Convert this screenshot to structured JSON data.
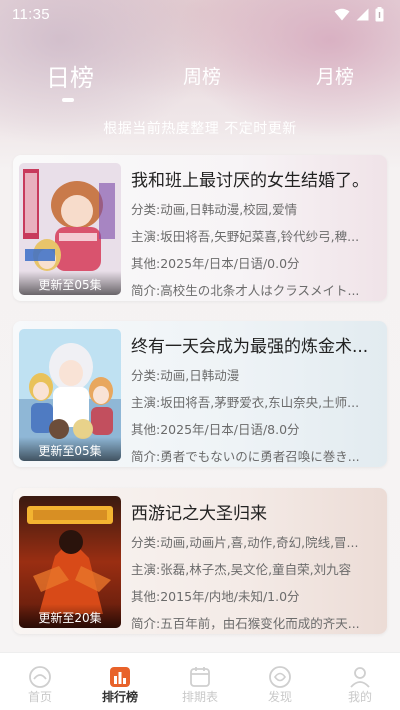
{
  "status_bar": {
    "time": "11:35"
  },
  "tabs": [
    {
      "label": "日榜",
      "active": true
    },
    {
      "label": "周榜",
      "active": false
    },
    {
      "label": "月榜",
      "active": false
    }
  ],
  "subtitle": "根据当前热度整理 不定时更新",
  "items": [
    {
      "title": "我和班上最讨厌的女生结婚了。",
      "category_label": "分类:",
      "category": "动画,日韩动漫,校园,爱情",
      "cast_label": "主演:",
      "cast": "坂田将吾,矢野妃菜喜,铃代纱弓,稗...",
      "other_label": "其他:",
      "other": "2025年/日本/日语/0.0分",
      "intro_label": "简介:",
      "intro": "高校生の北条才人はクラスメイト...",
      "badge": "更新至05集"
    },
    {
      "title": "终有一天会成为最强的炼金术...",
      "category_label": "分类:",
      "category": "动画,日韩动漫",
      "cast_label": "主演:",
      "cast": "坂田将吾,茅野爱衣,东山奈央,土师...",
      "other_label": "其他:",
      "other": "2025年/日本/日语/8.0分",
      "intro_label": "简介:",
      "intro": "勇者でもないのに勇者召喚に巻き...",
      "badge": "更新至05集"
    },
    {
      "title": "西游记之大圣归来",
      "category_label": "分类:",
      "category": "动画,动画片,喜,动作,奇幻,院线,冒...",
      "cast_label": "主演:",
      "cast": "张磊,林子杰,吴文伦,童自荣,刘九容",
      "other_label": "其他:",
      "other": "2015年/内地/未知/1.0分",
      "intro_label": "简介:",
      "intro": "五百年前，由石猴变化而成的齐天...",
      "badge": "更新至20集"
    }
  ],
  "bottom_nav": [
    {
      "label": "首页",
      "icon": "home-icon",
      "active": false
    },
    {
      "label": "排行榜",
      "icon": "ranking-icon",
      "active": true
    },
    {
      "label": "排期表",
      "icon": "schedule-icon",
      "active": false
    },
    {
      "label": "发现",
      "icon": "discover-icon",
      "active": false
    },
    {
      "label": "我的",
      "icon": "profile-icon",
      "active": false
    }
  ],
  "colors": {
    "accent": "#e8622a",
    "inactive_nav": "#c9c9c9"
  }
}
